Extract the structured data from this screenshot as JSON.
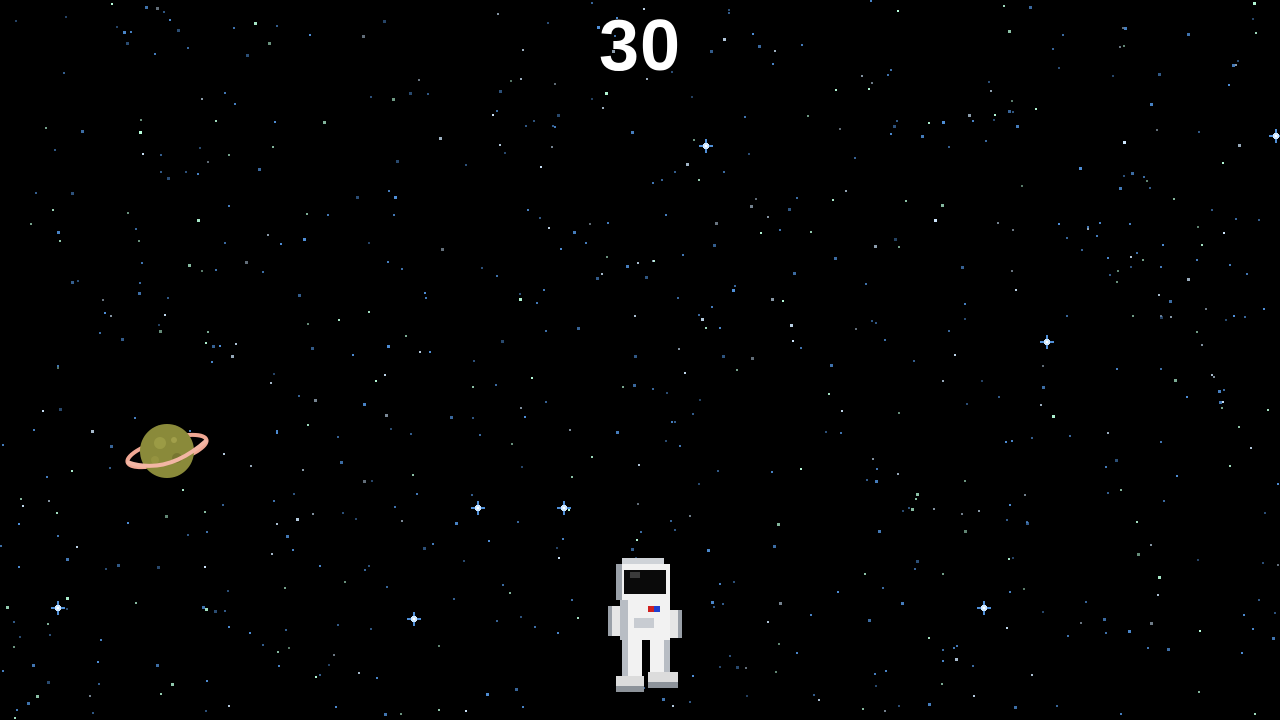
{
  "game": {
    "score": "30"
  },
  "sprites": {
    "player": "astronaut",
    "background_object": "ringed-planet"
  },
  "colors": {
    "background": "#000000",
    "score_text": "#ffffff",
    "star_blue": "#4f8fd8",
    "star_bright": "#cfe8ff",
    "star_mint": "#b8ffdc",
    "planet_body": "#8a8a3a",
    "planet_ring": "#f0a894",
    "suit_white": "#f2f2f2",
    "suit_shadow": "#9aa0a8",
    "visor": "#0a0a0a"
  }
}
